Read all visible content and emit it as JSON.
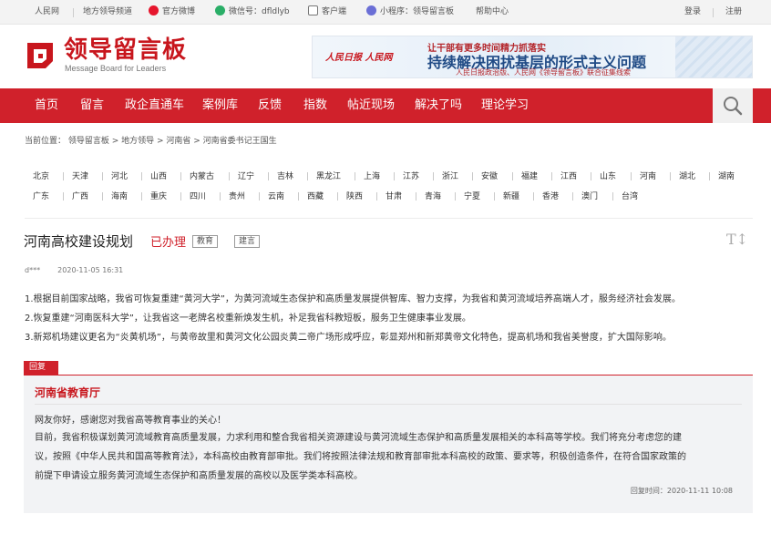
{
  "topbar": {
    "people": "人民网",
    "leader_channel": "地方领导频道",
    "weibo": "官方微博",
    "wechat": "微信号：dfldlyb",
    "client": "客户端",
    "miniprogram": "小程序：领导留言板",
    "help": "帮助中心",
    "login": "登录",
    "register": "注册"
  },
  "logo": {
    "cn": "领导留言板",
    "en": "Message Board for Leaders"
  },
  "banner": {
    "brand": "人民日报 人民网",
    "line1": "让干部有更多时间精力抓落实",
    "line2": "持续解决困扰基层的形式主义问题",
    "line3": "人民日报政治版、人民网《领导留言板》联合征集线索"
  },
  "nav": [
    "首页",
    "留言",
    "政企直通车",
    "案例库",
    "反馈",
    "指数",
    "帖近现场",
    "解决了吗",
    "理论学习"
  ],
  "breadcrumb": "当前位置： 领导留言板 > 地方领导 > 河南省 > 河南省委书记王国生",
  "provinces_row1": [
    "北京",
    "天津",
    "河北",
    "山西",
    "内蒙古",
    "辽宁",
    "吉林",
    "黑龙江",
    "上海",
    "江苏",
    "浙江",
    "安徽",
    "福建",
    "江西",
    "山东",
    "河南",
    "湖北",
    "湖南"
  ],
  "provinces_row2": [
    "广东",
    "广西",
    "海南",
    "重庆",
    "四川",
    "贵州",
    "云南",
    "西藏",
    "陕西",
    "甘肃",
    "青海",
    "宁夏",
    "新疆",
    "香港",
    "澳门",
    "台湾"
  ],
  "message": {
    "title": "河南高校建设规划",
    "status": "已办理",
    "tags": [
      "教育",
      "建言"
    ],
    "author": "d***",
    "time": "2020-11-05 16:31",
    "lines": [
      "1.根据目前国家战略，我省可恢复重建“黄河大学”，为黄河流域生态保护和高质量发展提供智库、智力支撑，为我省和黄河流域培养高端人才，服务经济社会发展。",
      "2.恢复重建“河南医科大学”，让我省这一老牌名校重新焕发生机，补足我省科教短板，服务卫生健康事业发展。",
      "3.新郑机场建议更名为“炎黄机场”，与黄帝故里和黄河文化公园炎黄二帝广场形成呼应，彰显郑州和新郑黄帝文化特色，提高机场和我省美誉度，扩大国际影响。"
    ]
  },
  "reply": {
    "tab": "回复",
    "org": "河南省教育厅",
    "lines": [
      "网友你好，感谢您对我省高等教育事业的关心！",
      "目前，我省积极谋划黄河流域教育高质量发展，力求利用和整合我省相关资源建设与黄河流域生态保护和高质量发展相关的本科高等学校。我们将充分考虑您的建",
      "议，按照《中华人民共和国高等教育法》，本科高校由教育部审批。我们将按照法律法规和教育部审批本科高校的政策、要求等，积极创造条件，在符合国家政策的",
      "前提下申请设立服务黄河流域生态保护和高质量发展的高校以及医学类本科高校。"
    ],
    "time": "回复时间：2020-11-11 10:08"
  },
  "colors": {
    "brand_red": "#d0212b",
    "reply_bg": "#f2f3f5"
  },
  "icons": [
    "weibo-icon",
    "wechat-icon",
    "client-icon",
    "miniprogram-icon",
    "search-icon",
    "font-size-icon"
  ]
}
